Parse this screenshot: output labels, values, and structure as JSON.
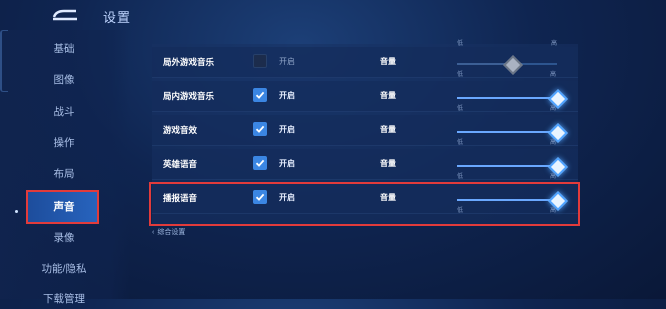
{
  "header": {
    "title": "设置"
  },
  "sidebar": {
    "items": [
      {
        "label": "基础"
      },
      {
        "label": "图像"
      },
      {
        "label": "战斗"
      },
      {
        "label": "操作"
      },
      {
        "label": "布局"
      },
      {
        "label": "声音",
        "active": true
      },
      {
        "label": "录像"
      },
      {
        "label": "功能/隐私"
      },
      {
        "label": "下载管理"
      }
    ]
  },
  "sound": {
    "top_scale": {
      "low": "低",
      "high": "高"
    },
    "rows": [
      {
        "label": "局外游戏音乐",
        "checked": false,
        "toggle_label": "开启",
        "volume_label": "音量",
        "volume": 0.55,
        "enabled": false,
        "low": "低",
        "high": "高"
      },
      {
        "label": "局内游戏音乐",
        "checked": true,
        "toggle_label": "开启",
        "volume_label": "音量",
        "volume": 1.0,
        "enabled": true,
        "low": "低",
        "high": "高"
      },
      {
        "label": "游戏音效",
        "checked": true,
        "toggle_label": "开启",
        "volume_label": "音量",
        "volume": 1.0,
        "enabled": true,
        "low": "低",
        "high": "高"
      },
      {
        "label": "英雄语音",
        "checked": true,
        "toggle_label": "开启",
        "volume_label": "音量",
        "volume": 1.0,
        "enabled": true,
        "low": "低",
        "high": "高"
      },
      {
        "label": "播报语音",
        "checked": true,
        "toggle_label": "开启",
        "volume_label": "音量",
        "volume": 1.0,
        "enabled": true,
        "low": "低",
        "high": "高"
      }
    ],
    "footer_link": "综合设置"
  },
  "colors": {
    "accent": "#3b86e3",
    "highlight": "#e23b3b"
  }
}
